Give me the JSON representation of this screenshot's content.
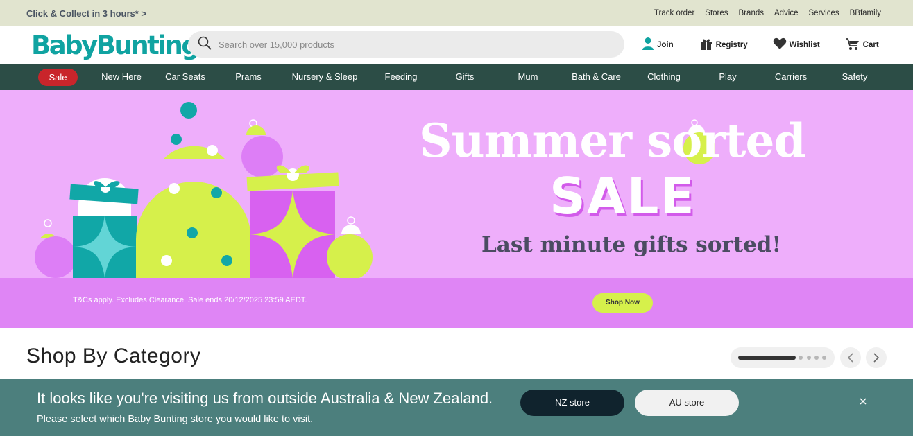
{
  "topbar": {
    "promo": "Click & Collect in 3 hours* >",
    "links": [
      "Track order",
      "Stores",
      "Brands",
      "Advice",
      "Services",
      "BBfamily"
    ]
  },
  "header": {
    "logo": "BabyBunting",
    "search_placeholder": "Search over 15,000 products",
    "actions": {
      "join": "Join",
      "registry": "Registry",
      "wishlist": "Wishlist",
      "cart": "Cart"
    }
  },
  "nav": {
    "sale": "Sale",
    "items": [
      "New Here",
      "Car Seats",
      "Prams",
      "Nursery & Sleep",
      "Feeding",
      "Gifts",
      "Mum",
      "Bath & Care",
      "Clothing",
      "Play",
      "Carriers",
      "Safety"
    ]
  },
  "hero": {
    "line1": "Summer sorted",
    "line2": "SALE",
    "line3": "Last minute gifts sorted!",
    "terms": "T&Cs apply. Excludes Clearance. Sale ends 20/12/2025 23:59 AEDT.",
    "cta": "Shop Now"
  },
  "category": {
    "title": "Shop By Category"
  },
  "region_banner": {
    "message": "It looks like you're visiting us from outside Australia & New Zealand.",
    "sub": "Please select which Baby Bunting store you would like to visit.",
    "nz_button": "NZ store",
    "au_button": "AU store"
  },
  "colors": {
    "brand_teal": "#10a3a1",
    "nav_bg": "#2c4d46",
    "sale_red": "#c9252b",
    "hero_bg": "#eeaefb",
    "hero_lime": "#d6f04b",
    "region_bg": "#4c7f7d"
  }
}
